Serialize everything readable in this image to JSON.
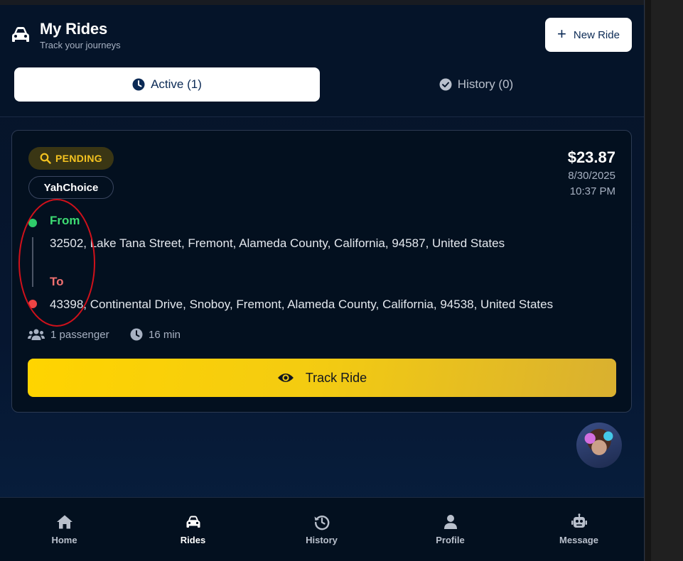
{
  "header": {
    "title": "My Rides",
    "subtitle": "Track your journeys",
    "new_ride_label": "New Ride"
  },
  "tabs": [
    {
      "label": "Active (1)",
      "active": true
    },
    {
      "label": "History (0)",
      "active": false
    }
  ],
  "ride": {
    "status": "PENDING",
    "service": "YahChoice",
    "price": "$23.87",
    "date": "8/30/2025",
    "time": "10:37 PM",
    "from_label": "From",
    "from_address": "32502, Lake Tana Street, Fremont, Alameda County, California, 94587, United States",
    "to_label": "To",
    "to_address": "43398, Continental Drive, Snoboy, Fremont, Alameda County, California, 94538, United States",
    "passengers": "1 passenger",
    "duration": "16 min",
    "track_label": "Track Ride"
  },
  "nav": [
    {
      "label": "Home",
      "icon": "home-icon",
      "active": false
    },
    {
      "label": "Rides",
      "icon": "car-icon",
      "active": true
    },
    {
      "label": "History",
      "icon": "history-icon",
      "active": false
    },
    {
      "label": "Profile",
      "icon": "user-icon",
      "active": false
    },
    {
      "label": "Message",
      "icon": "robot-icon",
      "active": false
    }
  ],
  "colors": {
    "background": "#061630",
    "accent": "#ffd400",
    "pending": "#f4c320",
    "from": "#3ddc73",
    "to": "#f07070",
    "annotation": "#d0111b"
  }
}
